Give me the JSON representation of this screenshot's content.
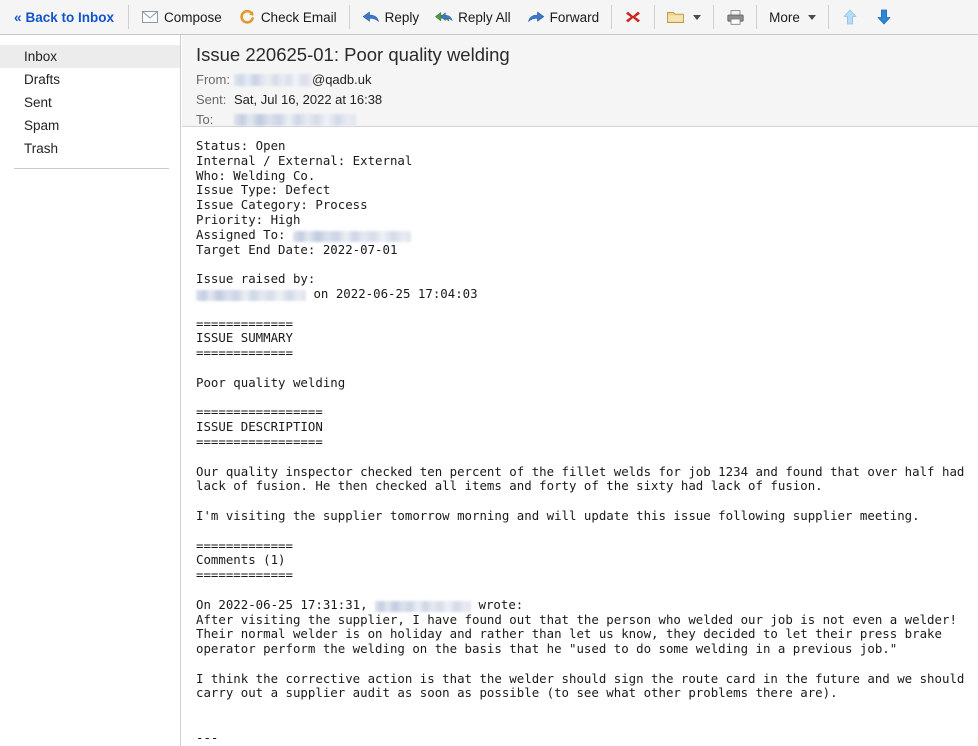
{
  "toolbar": {
    "back_label": "Back to Inbox",
    "back_chevron": "«",
    "compose_label": "Compose",
    "check_email_label": "Check Email",
    "reply_label": "Reply",
    "reply_all_label": "Reply All",
    "forward_label": "Forward",
    "more_label": "More",
    "icons": {
      "compose": "envelope-icon",
      "check_email": "refresh-icon",
      "reply": "reply-arrow-icon",
      "reply_all": "reply-all-arrow-icon",
      "forward": "forward-arrow-icon",
      "delete": "red-x-icon",
      "folder": "folder-icon",
      "print": "printer-icon",
      "previous": "up-arrow-icon",
      "next": "down-arrow-icon"
    },
    "accent_color": "#1155cc",
    "delete_color": "#d02020",
    "folder_color": "#e8c76a",
    "next_arrow_color": "#2f86d8",
    "prev_arrow_color": "#a9d0ef"
  },
  "sidebar": {
    "items": [
      {
        "label": "Inbox",
        "active": true
      },
      {
        "label": "Drafts",
        "active": false
      },
      {
        "label": "Sent",
        "active": false
      },
      {
        "label": "Spam",
        "active": false
      },
      {
        "label": "Trash",
        "active": false
      }
    ]
  },
  "message": {
    "subject": "Issue 220625-01: Poor quality welding",
    "from_label": "From:",
    "from_redacted_width": 78,
    "from_domain": "@qadb.uk",
    "sent_label": "Sent:",
    "sent_value": "Sat, Jul 16, 2022 at 16:38",
    "to_label": "To:",
    "to_redacted_width": 122,
    "body_lines": [
      {
        "text": "Status: Open"
      },
      {
        "text": "Internal / External: External"
      },
      {
        "text": "Who: Welding Co."
      },
      {
        "text": "Issue Type: Defect"
      },
      {
        "text": "Issue Category: Process"
      },
      {
        "text": "Priority: High"
      },
      {
        "text": "Assigned To: ",
        "redact_after": 118
      },
      {
        "text": "Target End Date: 2022-07-01"
      },
      {
        "text": ""
      },
      {
        "text": "Issue raised by:"
      },
      {
        "redact_before": 110,
        "text": " on 2022-06-25 17:04:03"
      },
      {
        "text": ""
      },
      {
        "text": "============="
      },
      {
        "text": "ISSUE SUMMARY"
      },
      {
        "text": "============="
      },
      {
        "text": ""
      },
      {
        "text": "Poor quality welding"
      },
      {
        "text": ""
      },
      {
        "text": "================="
      },
      {
        "text": "ISSUE DESCRIPTION"
      },
      {
        "text": "================="
      },
      {
        "text": ""
      },
      {
        "text": "Our quality inspector checked ten percent of the fillet welds for job 1234 and found that over half had"
      },
      {
        "text": "lack of fusion. He then checked all items and forty of the sixty had lack of fusion."
      },
      {
        "text": ""
      },
      {
        "text": "I'm visiting the supplier tomorrow morning and will update this issue following supplier meeting."
      },
      {
        "text": ""
      },
      {
        "text": "============="
      },
      {
        "text": "Comments (1)"
      },
      {
        "text": "============="
      },
      {
        "text": ""
      },
      {
        "text": "On 2022-06-25 17:31:31, ",
        "redact_after": 96,
        "text_after": " wrote:"
      },
      {
        "text": "After visiting the supplier, I have found out that the person who welded our job is not even a welder!"
      },
      {
        "text": "Their normal welder is on holiday and rather than let us know, they decided to let their press brake"
      },
      {
        "text": "operator perform the welding on the basis that he \"used to do some welding in a previous job.\""
      },
      {
        "text": ""
      },
      {
        "text": "I think the corrective action is that the welder should sign the route card in the future and we should"
      },
      {
        "text": "carry out a supplier audit as soon as possible (to see what other problems there are)."
      },
      {
        "text": ""
      },
      {
        "text": ""
      },
      {
        "text": "---"
      }
    ]
  }
}
